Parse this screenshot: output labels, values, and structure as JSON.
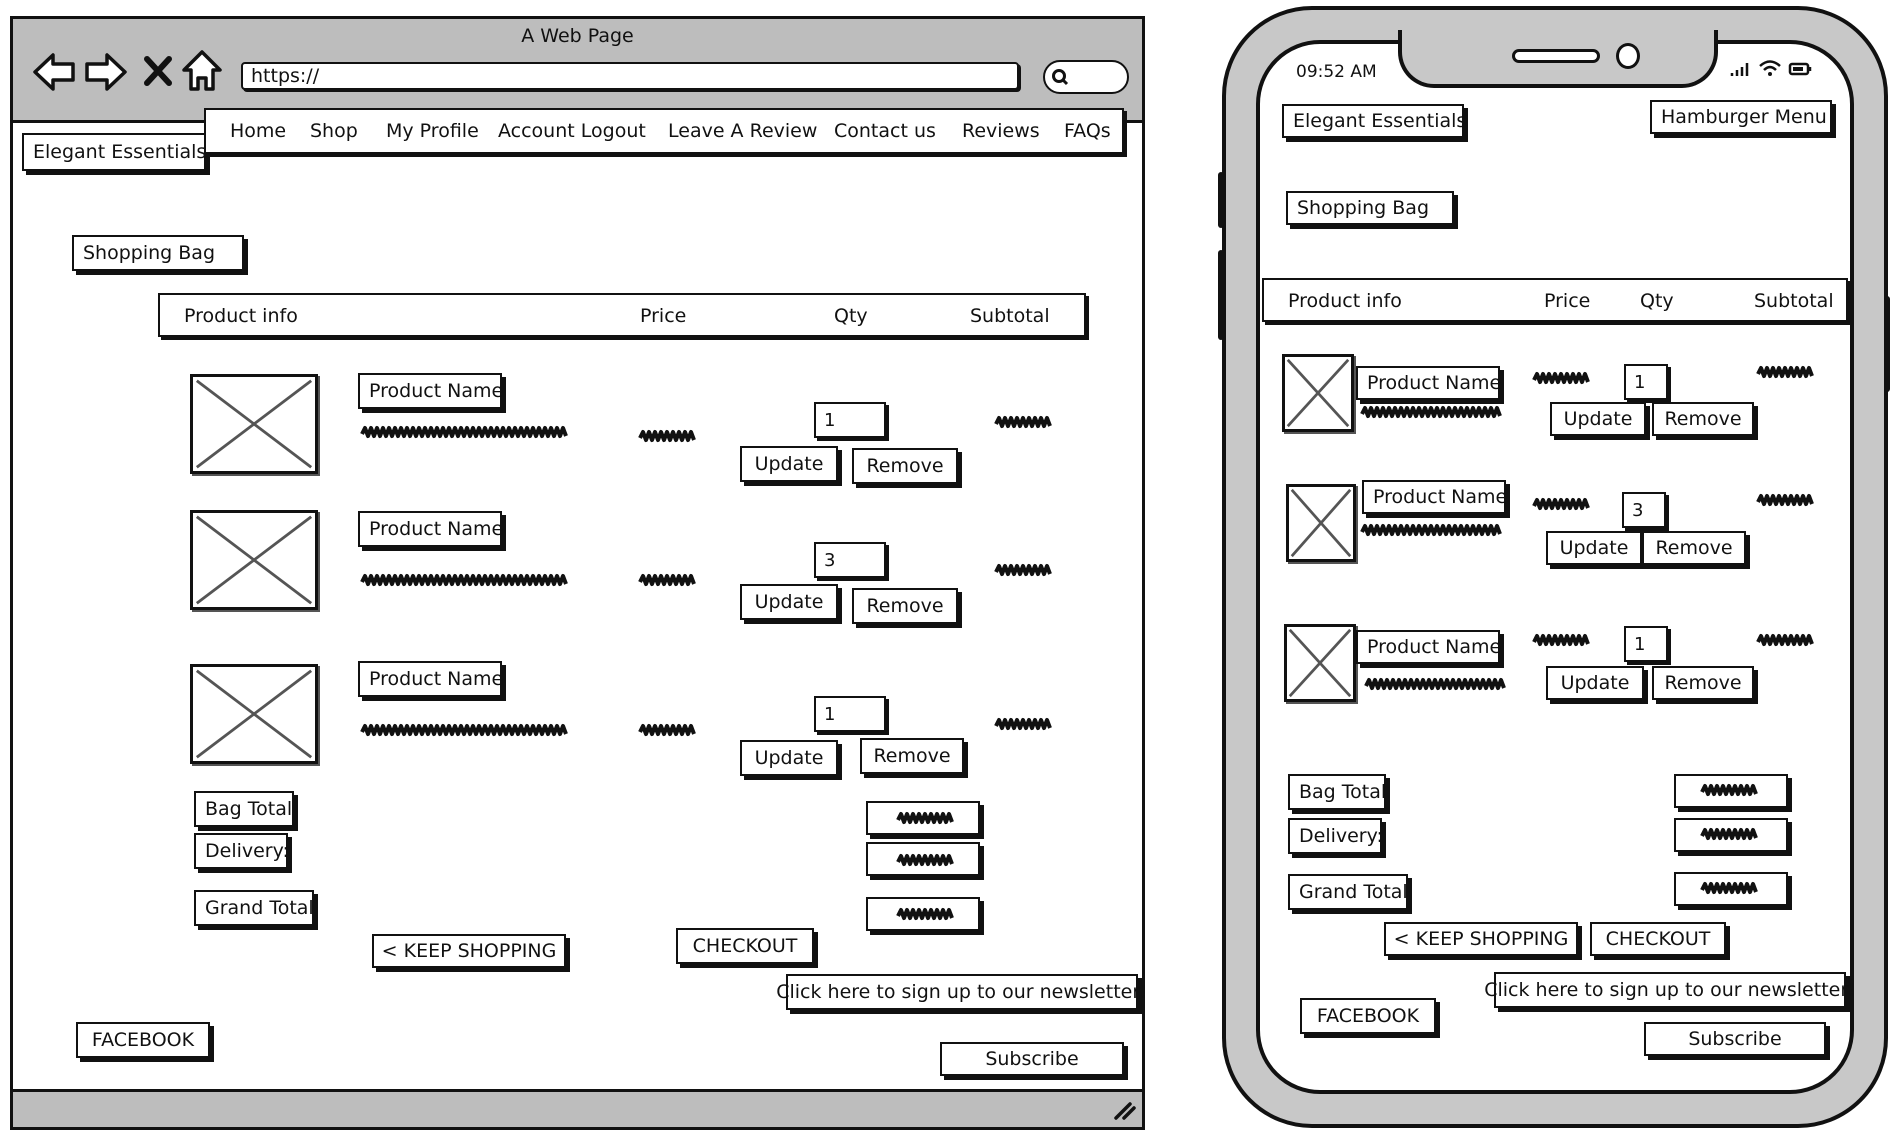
{
  "browser": {
    "title": "A Web Page",
    "url": "https://",
    "brand": "Elegant Essentials",
    "nav": [
      "Home",
      "Shop",
      "My Profile",
      "Account Logout",
      "Leave A Review",
      "Contact us",
      "Reviews",
      "FAQs"
    ],
    "page_heading": "Shopping Bag",
    "table_headers": {
      "product": "Product info",
      "price": "Price",
      "qty": "Qty",
      "subtotal": "Subtotal"
    },
    "items": [
      {
        "name": "Product Name",
        "qty": "1",
        "update": "Update",
        "remove": "Remove"
      },
      {
        "name": "Product Name",
        "qty": "3",
        "update": "Update",
        "remove": "Remove"
      },
      {
        "name": "Product Name",
        "qty": "1",
        "update": "Update",
        "remove": "Remove"
      }
    ],
    "totals": {
      "bag_total": "Bag Total",
      "delivery": "Delivery:",
      "grand_total": "Grand Total"
    },
    "keep_shopping": "< KEEP SHOPPING",
    "checkout": "CHECKOUT",
    "newsletter": "Click here to sign up to our newsletter!",
    "facebook": "FACEBOOK",
    "subscribe": "Subscribe"
  },
  "mobile": {
    "time": "09:52 AM",
    "brand": "Elegant Essentials",
    "menu": "Hamburger Menu",
    "page_heading": "Shopping Bag",
    "table_headers": {
      "product": "Product info",
      "price": "Price",
      "qty": "Qty",
      "subtotal": "Subtotal"
    },
    "items": [
      {
        "name": "Product Name",
        "qty": "1",
        "update": "Update",
        "remove": "Remove"
      },
      {
        "name": "Product Name",
        "qty": "3",
        "update": "Update",
        "remove": "Remove"
      },
      {
        "name": "Product Name",
        "qty": "1",
        "update": "Update",
        "remove": "Remove"
      }
    ],
    "totals": {
      "bag_total": "Bag Total",
      "delivery": "Delivery:",
      "grand_total": "Grand Total"
    },
    "keep_shopping": "< KEEP SHOPPING",
    "checkout": "CHECKOUT",
    "newsletter": "Click here to sign up to our newsletter!",
    "facebook": "FACEBOOK",
    "subscribe": "Subscribe"
  },
  "icons": [
    "back-arrow-icon",
    "forward-arrow-icon",
    "close-icon",
    "home-icon",
    "search-icon",
    "resize-grip-icon",
    "signal-icon",
    "wifi-icon",
    "battery-icon"
  ]
}
